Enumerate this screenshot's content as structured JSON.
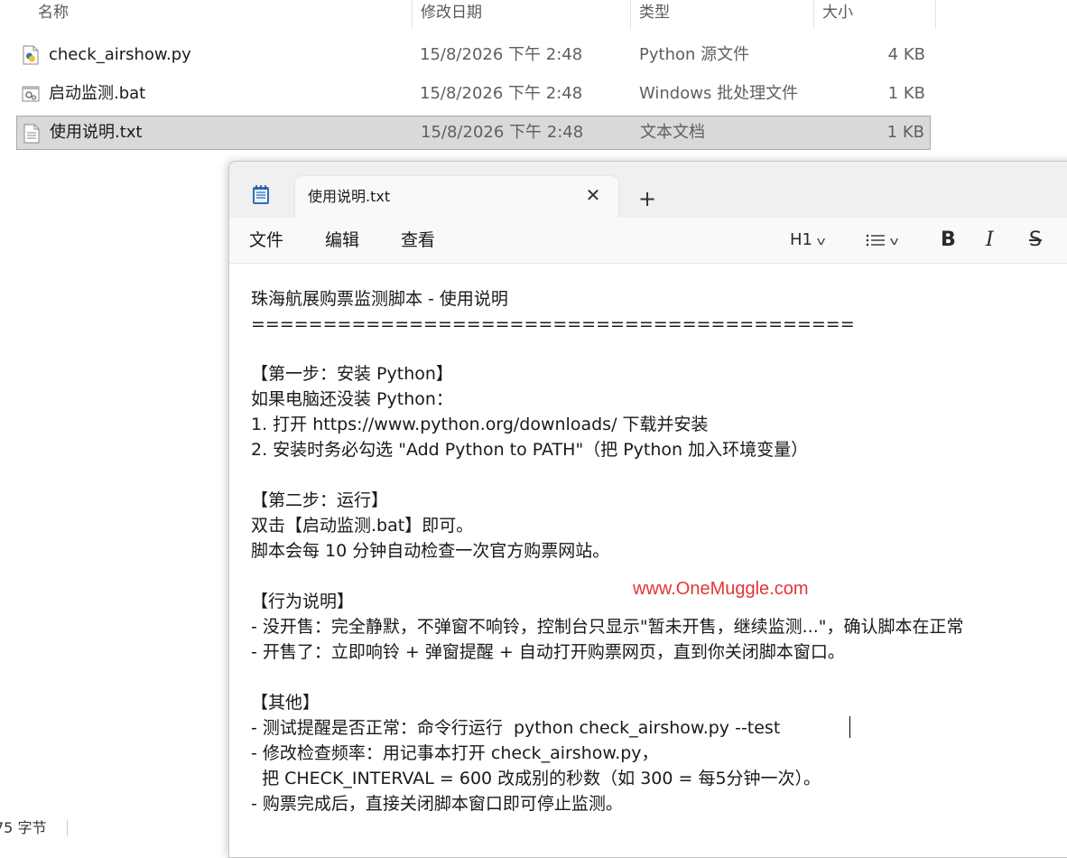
{
  "explorer": {
    "columns": {
      "name": "名称",
      "modified": "修改日期",
      "type": "类型",
      "size": "大小"
    },
    "files": [
      {
        "name": "check_airshow.py",
        "modified": "15/8/2026 下午 2:48",
        "type": "Python 源文件",
        "size": "4 KB",
        "icon": "python-file-icon"
      },
      {
        "name": "启动监测.bat",
        "modified": "15/8/2026 下午 2:48",
        "type": "Windows 批处理文件",
        "size": "1 KB",
        "icon": "batch-file-icon"
      },
      {
        "name": "使用说明.txt",
        "modified": "15/8/2026 下午 2:48",
        "type": "文本文档",
        "size": "1 KB",
        "icon": "text-file-icon",
        "selected": true
      }
    ],
    "status_text": "75 字节"
  },
  "notepad": {
    "tab_title": "使用说明.txt",
    "menu": {
      "file": "文件",
      "edit": "编辑",
      "view": "查看"
    },
    "format": {
      "heading": "H1",
      "bold": "B",
      "italic": "I",
      "strike": "S"
    },
    "lines": [
      "珠海航展购票监测脚本 - 使用说明",
      "==========================================",
      "",
      "【第一步：安装 Python】",
      "如果电脑还没装 Python：",
      "1. 打开 https://www.python.org/downloads/ 下载并安装",
      "2. 安装时务必勾选 \"Add Python to PATH\"（把 Python 加入环境变量）",
      "",
      "【第二步：运行】",
      "双击【启动监测.bat】即可。",
      "脚本会每 10 分钟自动检查一次官方购票网站。",
      "",
      "【行为说明】",
      "- 没开售：完全静默，不弹窗不响铃，控制台只显示\"暂未开售，继续监测...\"，确认脚本在正常",
      "- 开售了：立即响铃 + 弹窗提醒 + 自动打开购票网页，直到你关闭脚本窗口。",
      "",
      "【其他】",
      "- 测试提醒是否正常：命令行运行  python check_airshow.py --test",
      "- 修改检查频率：用记事本打开 check_airshow.py，",
      "  把 CHECK_INTERVAL = 600 改成别的秒数（如 300 = 每5分钟一次）。",
      "- 购票完成后，直接关闭脚本窗口即可停止监测。"
    ],
    "watermark": "www.OneMuggle.com"
  },
  "colors": {
    "selection": "#d9d9d9",
    "watermark": "#e02020"
  }
}
